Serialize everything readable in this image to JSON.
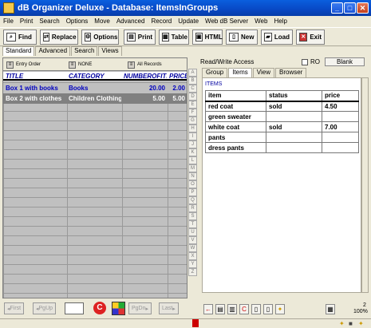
{
  "window": {
    "title": "dB Organizer Deluxe - Database: ItemsInGroups",
    "min": "_",
    "max": "□",
    "close": "✕"
  },
  "menu": [
    "File",
    "Print",
    "Search",
    "Options",
    "Move",
    "Advanced",
    "Record",
    "Update",
    "Web dB Server",
    "Web",
    "Help"
  ],
  "toolbar": {
    "find": "Find",
    "replace": "Replace",
    "options": "Options",
    "print": "Print",
    "table": "Table",
    "html": "HTML",
    "new": "New",
    "load": "Load",
    "exit": "Exit"
  },
  "view_tabs": [
    "Standard",
    "Advanced",
    "Search",
    "Views"
  ],
  "left": {
    "sort_label": "Entry Order",
    "filter_label": "NONE",
    "records_label": "All Records",
    "columns": [
      "TITLE",
      "CATEGORY",
      "NUMBEROFITEMS",
      "PRICE"
    ],
    "rows": [
      {
        "title": "Box 1 with books",
        "category": "Books",
        "number": "20.00",
        "price": "2.00"
      },
      {
        "title": "Box 2 with clothes",
        "category": "Children Clothing",
        "number": "5.00",
        "price": "5.00"
      }
    ]
  },
  "alphabet": [
    "A",
    "B",
    "C",
    "D",
    "E",
    "F",
    "G",
    "H",
    "I",
    "J",
    "K",
    "L",
    "M",
    "N",
    "O",
    "P",
    "Q",
    "R",
    "S",
    "T",
    "U",
    "V",
    "W",
    "X",
    "Y",
    "Z"
  ],
  "nav": {
    "first": "First",
    "pgup": "PgUp",
    "pgdn": "PgDn",
    "last": "Last"
  },
  "right": {
    "access": "Read/Write Access",
    "ro": "RO",
    "blank": "Blank",
    "tabs": [
      "Group",
      "Items",
      "View",
      "Browser"
    ],
    "items_title": "ITEMS",
    "columns": [
      "item",
      "status",
      "price"
    ],
    "rows": [
      {
        "item": "red coat",
        "status": "sold",
        "price": "4.50"
      },
      {
        "item": "green sweater",
        "status": "",
        "price": ""
      },
      {
        "item": "white coat",
        "status": "sold",
        "price": "7.00"
      },
      {
        "item": "pants",
        "status": "",
        "price": ""
      },
      {
        "item": "dress pants",
        "status": "",
        "price": ""
      }
    ]
  },
  "status": {
    "count": "2",
    "zoom": "100%"
  },
  "colors": {
    "title_bar": "#0848c4",
    "header_text": "#0000a0",
    "selected_row": "#808080"
  }
}
